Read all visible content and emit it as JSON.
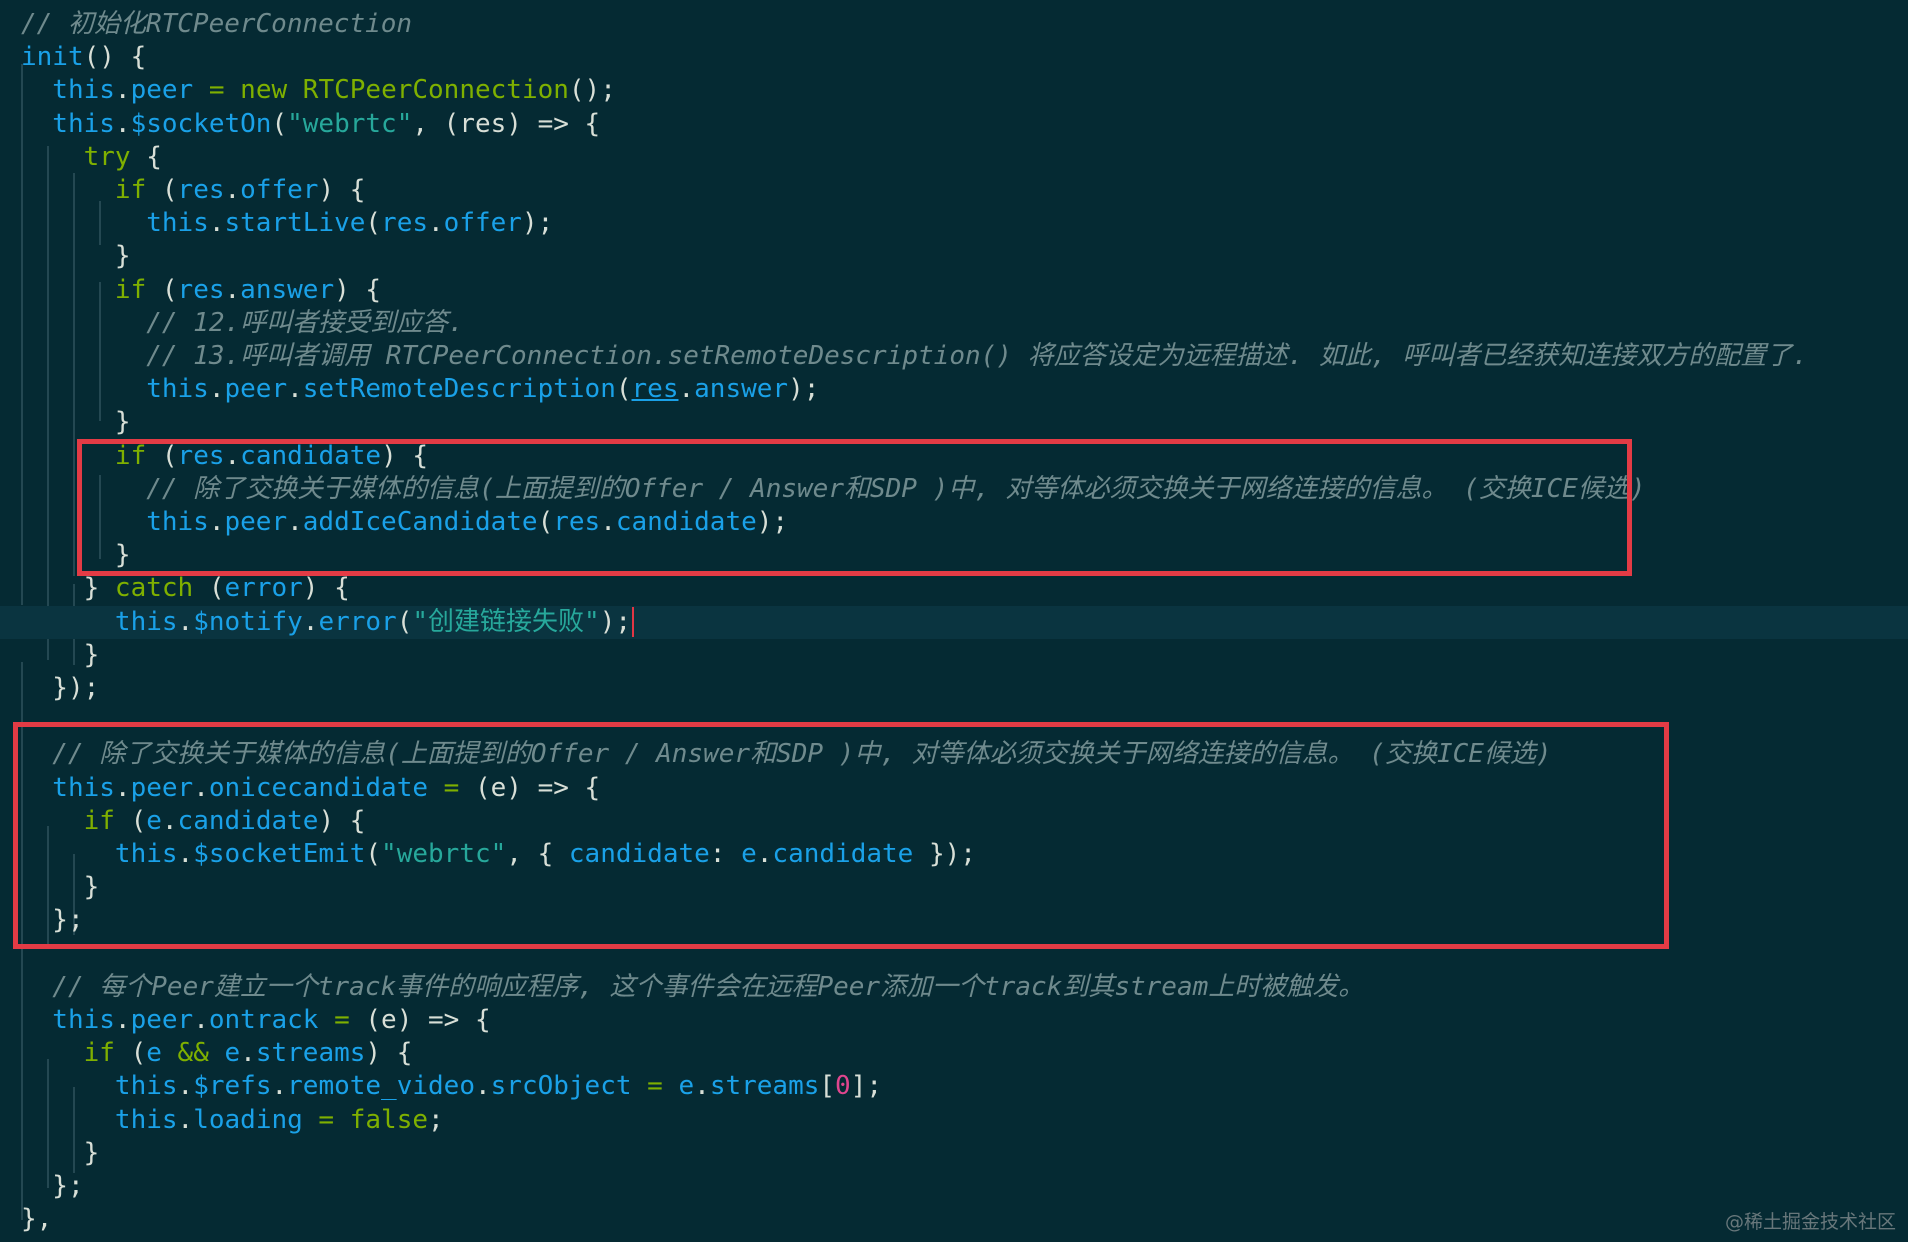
{
  "colors": {
    "background": "#052a33",
    "comment": "#6f8a8d",
    "keyword": "#7fb000",
    "identifier": "#1aa1e8",
    "string": "#27a89b",
    "number": "#e0468e",
    "text": "#d8dfd7",
    "highlight_border": "#e33b45",
    "active_line": "#0a3440"
  },
  "editor": {
    "lines": [
      {
        "tokens": [
          {
            "text": "// 初始化RTCPeerConnection",
            "kind": "comment"
          }
        ]
      },
      {
        "tokens": [
          {
            "text": "init",
            "kind": "identifier"
          },
          {
            "text": "() {",
            "kind": "punctuation"
          }
        ]
      },
      {
        "tokens": [
          {
            "text": "  this",
            "kind": "identifier"
          },
          {
            "text": ".",
            "kind": "punctuation"
          },
          {
            "text": "peer",
            "kind": "identifier"
          },
          {
            "text": " = ",
            "kind": "keyword"
          },
          {
            "text": "new ",
            "kind": "keyword"
          },
          {
            "text": "RTCPeerConnection",
            "kind": "keyword"
          },
          {
            "text": "();",
            "kind": "punctuation"
          }
        ]
      },
      {
        "tokens": [
          {
            "text": "  this",
            "kind": "identifier"
          },
          {
            "text": ".",
            "kind": "punctuation"
          },
          {
            "text": "$socketOn",
            "kind": "identifier"
          },
          {
            "text": "(",
            "kind": "punctuation"
          },
          {
            "text": "\"webrtc\"",
            "kind": "string"
          },
          {
            "text": ", (res) => {",
            "kind": "punctuation"
          }
        ]
      },
      {
        "tokens": [
          {
            "text": "    try",
            "kind": "keyword"
          },
          {
            "text": " {",
            "kind": "punctuation"
          }
        ]
      },
      {
        "tokens": [
          {
            "text": "      if",
            "kind": "keyword"
          },
          {
            "text": " (",
            "kind": "punctuation"
          },
          {
            "text": "res",
            "kind": "identifier"
          },
          {
            "text": ".",
            "kind": "punctuation"
          },
          {
            "text": "offer",
            "kind": "identifier"
          },
          {
            "text": ") {",
            "kind": "punctuation"
          }
        ]
      },
      {
        "tokens": [
          {
            "text": "        this",
            "kind": "identifier"
          },
          {
            "text": ".",
            "kind": "punctuation"
          },
          {
            "text": "startLive",
            "kind": "identifier"
          },
          {
            "text": "(",
            "kind": "punctuation"
          },
          {
            "text": "res",
            "kind": "identifier"
          },
          {
            "text": ".",
            "kind": "punctuation"
          },
          {
            "text": "offer",
            "kind": "identifier"
          },
          {
            "text": ");",
            "kind": "punctuation"
          }
        ]
      },
      {
        "tokens": [
          {
            "text": "      }",
            "kind": "punctuation"
          }
        ]
      },
      {
        "tokens": [
          {
            "text": "      if",
            "kind": "keyword"
          },
          {
            "text": " (",
            "kind": "punctuation"
          },
          {
            "text": "res",
            "kind": "identifier"
          },
          {
            "text": ".",
            "kind": "punctuation"
          },
          {
            "text": "answer",
            "kind": "identifier"
          },
          {
            "text": ") {",
            "kind": "punctuation"
          }
        ]
      },
      {
        "tokens": [
          {
            "text": "        // 12.呼叫者接受到应答.",
            "kind": "comment"
          }
        ]
      },
      {
        "tokens": [
          {
            "text": "        // 13.呼叫者调用 RTCPeerConnection.setRemoteDescription() 将应答设定为远程描述. 如此, 呼叫者已经获知连接双方的配置了.",
            "kind": "comment"
          }
        ]
      },
      {
        "tokens": [
          {
            "text": "        this",
            "kind": "identifier"
          },
          {
            "text": ".",
            "kind": "punctuation"
          },
          {
            "text": "peer",
            "kind": "identifier"
          },
          {
            "text": ".",
            "kind": "punctuation"
          },
          {
            "text": "setRemoteDescription",
            "kind": "identifier"
          },
          {
            "text": "(",
            "kind": "punctuation"
          },
          {
            "text": "res",
            "kind": "identifier",
            "underline": true
          },
          {
            "text": ".",
            "kind": "punctuation"
          },
          {
            "text": "answer",
            "kind": "identifier"
          },
          {
            "text": ");",
            "kind": "punctuation"
          }
        ]
      },
      {
        "tokens": [
          {
            "text": "      }",
            "kind": "punctuation"
          }
        ]
      },
      {
        "tokens": [
          {
            "text": "      if",
            "kind": "keyword"
          },
          {
            "text": " (",
            "kind": "punctuation"
          },
          {
            "text": "res",
            "kind": "identifier"
          },
          {
            "text": ".",
            "kind": "punctuation"
          },
          {
            "text": "candidate",
            "kind": "identifier"
          },
          {
            "text": ") {",
            "kind": "punctuation"
          }
        ]
      },
      {
        "tokens": [
          {
            "text": "        // 除了交换关于媒体的信息(上面提到的Offer / Answer和SDP )中, 对等体必须交换关于网络连接的信息。 (交换ICE候选)",
            "kind": "comment"
          }
        ]
      },
      {
        "tokens": [
          {
            "text": "        this",
            "kind": "identifier"
          },
          {
            "text": ".",
            "kind": "punctuation"
          },
          {
            "text": "peer",
            "kind": "identifier"
          },
          {
            "text": ".",
            "kind": "punctuation"
          },
          {
            "text": "addIceCandidate",
            "kind": "identifier"
          },
          {
            "text": "(",
            "kind": "punctuation"
          },
          {
            "text": "res",
            "kind": "identifier"
          },
          {
            "text": ".",
            "kind": "punctuation"
          },
          {
            "text": "candidate",
            "kind": "identifier"
          },
          {
            "text": ");",
            "kind": "punctuation"
          }
        ]
      },
      {
        "tokens": [
          {
            "text": "      }",
            "kind": "punctuation"
          }
        ]
      },
      {
        "tokens": [
          {
            "text": "    } ",
            "kind": "punctuation"
          },
          {
            "text": "catch",
            "kind": "keyword"
          },
          {
            "text": " (",
            "kind": "punctuation"
          },
          {
            "text": "error",
            "kind": "identifier"
          },
          {
            "text": ") {",
            "kind": "punctuation"
          }
        ]
      },
      {
        "tokens": [
          {
            "text": "      this",
            "kind": "identifier"
          },
          {
            "text": ".",
            "kind": "punctuation"
          },
          {
            "text": "$notify",
            "kind": "identifier"
          },
          {
            "text": ".",
            "kind": "punctuation"
          },
          {
            "text": "error",
            "kind": "identifier"
          },
          {
            "text": "(",
            "kind": "punctuation"
          },
          {
            "text": "\"创建链接失败\"",
            "kind": "string"
          },
          {
            "text": ");",
            "kind": "punctuation"
          }
        ]
      },
      {
        "tokens": [
          {
            "text": "    }",
            "kind": "punctuation"
          }
        ]
      },
      {
        "tokens": [
          {
            "text": "  });",
            "kind": "punctuation"
          }
        ]
      },
      {
        "tokens": [
          {
            "text": "",
            "kind": "plain"
          }
        ]
      },
      {
        "tokens": [
          {
            "text": "  // 除了交换关于媒体的信息(上面提到的Offer / Answer和SDP )中, 对等体必须交换关于网络连接的信息。 (交换ICE候选)",
            "kind": "comment"
          }
        ]
      },
      {
        "tokens": [
          {
            "text": "  this",
            "kind": "identifier"
          },
          {
            "text": ".",
            "kind": "punctuation"
          },
          {
            "text": "peer",
            "kind": "identifier"
          },
          {
            "text": ".",
            "kind": "punctuation"
          },
          {
            "text": "onicecandidate",
            "kind": "identifier"
          },
          {
            "text": " = ",
            "kind": "keyword"
          },
          {
            "text": "(e) => {",
            "kind": "punctuation"
          }
        ]
      },
      {
        "tokens": [
          {
            "text": "    if",
            "kind": "keyword"
          },
          {
            "text": " (",
            "kind": "punctuation"
          },
          {
            "text": "e",
            "kind": "identifier"
          },
          {
            "text": ".",
            "kind": "punctuation"
          },
          {
            "text": "candidate",
            "kind": "identifier"
          },
          {
            "text": ") {",
            "kind": "punctuation"
          }
        ]
      },
      {
        "tokens": [
          {
            "text": "      this",
            "kind": "identifier"
          },
          {
            "text": ".",
            "kind": "punctuation"
          },
          {
            "text": "$socketEmit",
            "kind": "identifier"
          },
          {
            "text": "(",
            "kind": "punctuation"
          },
          {
            "text": "\"webrtc\"",
            "kind": "string"
          },
          {
            "text": ", { ",
            "kind": "punctuation"
          },
          {
            "text": "candidate",
            "kind": "identifier"
          },
          {
            "text": ": ",
            "kind": "punctuation"
          },
          {
            "text": "e",
            "kind": "identifier"
          },
          {
            "text": ".",
            "kind": "punctuation"
          },
          {
            "text": "candidate",
            "kind": "identifier"
          },
          {
            "text": " });",
            "kind": "punctuation"
          }
        ]
      },
      {
        "tokens": [
          {
            "text": "    }",
            "kind": "punctuation"
          }
        ]
      },
      {
        "tokens": [
          {
            "text": "  };",
            "kind": "punctuation"
          }
        ]
      },
      {
        "tokens": [
          {
            "text": "",
            "kind": "plain"
          }
        ]
      },
      {
        "tokens": [
          {
            "text": "  // 每个Peer建立一个track事件的响应程序, 这个事件会在远程Peer添加一个track到其stream上时被触发。",
            "kind": "comment"
          }
        ]
      },
      {
        "tokens": [
          {
            "text": "  this",
            "kind": "identifier"
          },
          {
            "text": ".",
            "kind": "punctuation"
          },
          {
            "text": "peer",
            "kind": "identifier"
          },
          {
            "text": ".",
            "kind": "punctuation"
          },
          {
            "text": "ontrack",
            "kind": "identifier"
          },
          {
            "text": " = ",
            "kind": "keyword"
          },
          {
            "text": "(e) => {",
            "kind": "punctuation"
          }
        ]
      },
      {
        "tokens": [
          {
            "text": "    if",
            "kind": "keyword"
          },
          {
            "text": " (",
            "kind": "punctuation"
          },
          {
            "text": "e",
            "kind": "identifier"
          },
          {
            "text": " && ",
            "kind": "keyword"
          },
          {
            "text": "e",
            "kind": "identifier"
          },
          {
            "text": ".",
            "kind": "punctuation"
          },
          {
            "text": "streams",
            "kind": "identifier"
          },
          {
            "text": ") {",
            "kind": "punctuation"
          }
        ]
      },
      {
        "tokens": [
          {
            "text": "      this",
            "kind": "identifier"
          },
          {
            "text": ".",
            "kind": "punctuation"
          },
          {
            "text": "$refs",
            "kind": "identifier"
          },
          {
            "text": ".",
            "kind": "punctuation"
          },
          {
            "text": "remote_video",
            "kind": "identifier"
          },
          {
            "text": ".",
            "kind": "punctuation"
          },
          {
            "text": "srcObject",
            "kind": "identifier"
          },
          {
            "text": " = ",
            "kind": "keyword"
          },
          {
            "text": "e",
            "kind": "identifier"
          },
          {
            "text": ".",
            "kind": "punctuation"
          },
          {
            "text": "streams",
            "kind": "identifier"
          },
          {
            "text": "[",
            "kind": "punctuation"
          },
          {
            "text": "0",
            "kind": "number"
          },
          {
            "text": "];",
            "kind": "punctuation"
          }
        ]
      },
      {
        "tokens": [
          {
            "text": "      this",
            "kind": "identifier"
          },
          {
            "text": ".",
            "kind": "punctuation"
          },
          {
            "text": "loading",
            "kind": "identifier"
          },
          {
            "text": " = ",
            "kind": "keyword"
          },
          {
            "text": "false",
            "kind": "keyword"
          },
          {
            "text": ";",
            "kind": "punctuation"
          }
        ]
      },
      {
        "tokens": [
          {
            "text": "    }",
            "kind": "punctuation"
          }
        ]
      },
      {
        "tokens": [
          {
            "text": "  };",
            "kind": "punctuation"
          }
        ]
      },
      {
        "tokens": [
          {
            "text": "},",
            "kind": "punctuation"
          }
        ]
      }
    ]
  },
  "watermark": "@稀土掘金技术社区"
}
